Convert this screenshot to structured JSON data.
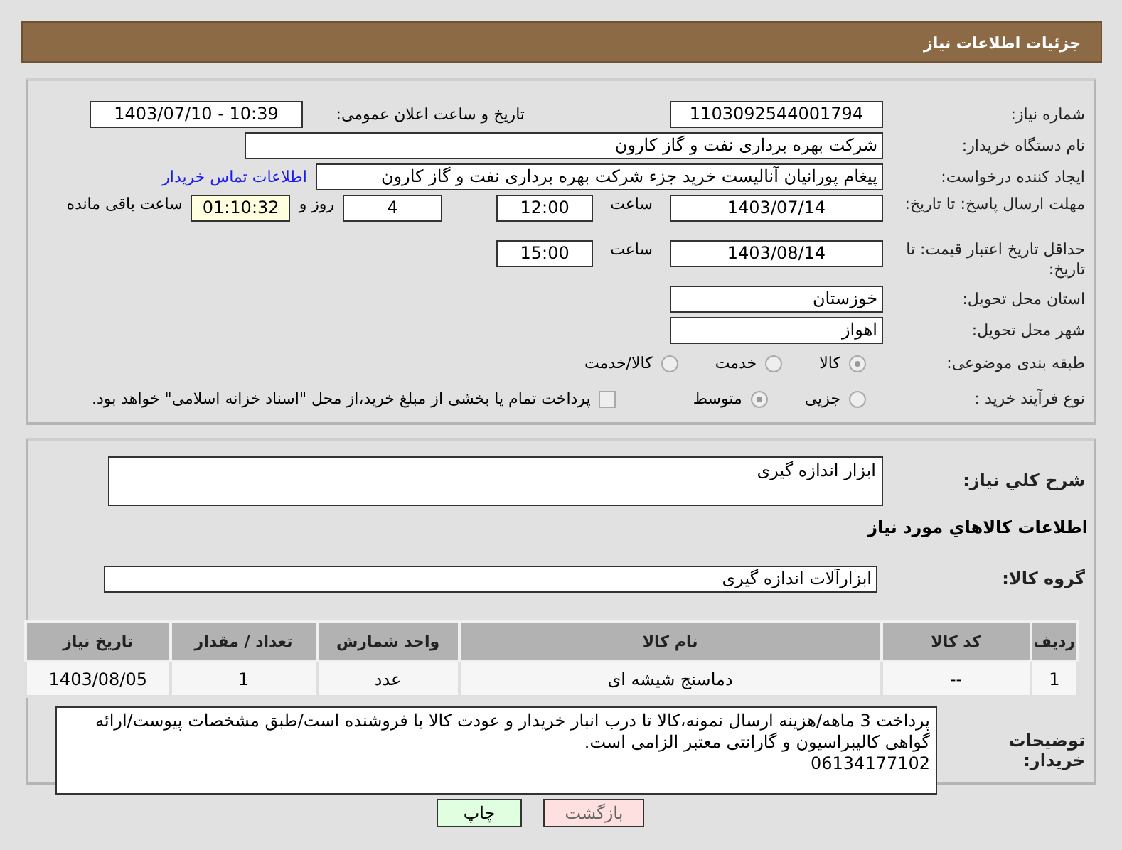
{
  "page_title": "جزئیات اطلاعات نیاز",
  "need_number": {
    "label": "شماره نیاز:",
    "value": "1103092544001794"
  },
  "announce": {
    "label": "تاریخ و ساعت اعلان عمومی:",
    "value": "1403/07/10 - 10:39"
  },
  "buyer_org": {
    "label": "نام دستگاه خریدار:",
    "value": "شرکت بهره برداری نفت و گاز کارون"
  },
  "requester": {
    "label": "ایجاد کننده درخواست:",
    "value": "پیغام پورانیان آنالیست خرید جزء شرکت بهره برداری نفت و گاز کارون",
    "link": "اطلاعات تماس خریدار"
  },
  "response_deadline": {
    "label": "مهلت ارسال پاسخ: تا تاریخ:",
    "date": "1403/07/14",
    "time_label": "ساعت",
    "time": "12:00",
    "days": "4",
    "days_label": "روز و",
    "remaining": "01:10:32",
    "remaining_label": "ساعت باقی مانده"
  },
  "price_validity": {
    "label": "حداقل تاریخ اعتبار قیمت: تا تاریخ:",
    "date": "1403/08/14",
    "time_label": "ساعت",
    "time": "15:00"
  },
  "province": {
    "label": "استان محل تحویل:",
    "value": "خوزستان"
  },
  "city": {
    "label": "شهر محل تحویل:",
    "value": "اهواز"
  },
  "category": {
    "label": "طبقه بندی موضوعی:",
    "options": [
      {
        "label": "کالا",
        "selected": true
      },
      {
        "label": "خدمت",
        "selected": false
      },
      {
        "label": "کالا/خدمت",
        "selected": false
      }
    ]
  },
  "purchase_type": {
    "label": "نوع فرآیند خرید :",
    "options": [
      {
        "label": "جزیی",
        "selected": false
      },
      {
        "label": "متوسط",
        "selected": true
      }
    ],
    "treasury": {
      "label": "پرداخت تمام یا بخشی از مبلغ خرید،از محل \"اسناد خزانه اسلامی\" خواهد بود.",
      "checked": false
    }
  },
  "description": {
    "label": "شرح کلي نياز:",
    "value": "ابزار اندازه گیری"
  },
  "goods_heading": "اطلاعات کالاهاي مورد نياز",
  "goods_group": {
    "label": "گروه کالا:",
    "value": "ابزارآلات اندازه گیری"
  },
  "table": {
    "columns": [
      "ردیف",
      "کد کالا",
      "نام کالا",
      "واحد شمارش",
      "تعداد / مقدار",
      "تاریخ نیاز"
    ],
    "rows": [
      [
        "1",
        "--",
        "دماسنج شیشه ای",
        "عدد",
        "1",
        "1403/08/05"
      ]
    ]
  },
  "buyer_notes": {
    "label": "توضیحات خریدار:",
    "value": "پرداخت 3 ماهه/هزینه ارسال نمونه،کالا تا درب انبار خریدار و عودت کالا با فروشنده است/طبق مشخصات پیوست/ارائه گواهی کالیبراسیون و گارانتی معتبر الزامی است.\n06134177102"
  },
  "buttons": [
    {
      "label": "بازگشت",
      "kind": "back"
    },
    {
      "label": "چاپ",
      "kind": "print"
    }
  ]
}
